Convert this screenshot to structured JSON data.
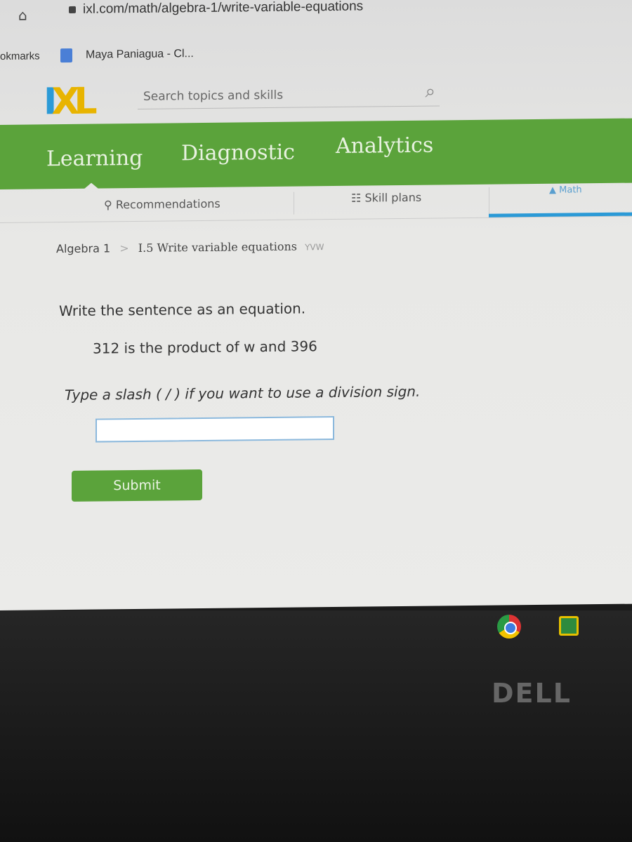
{
  "browser": {
    "url": "ixl.com/math/algebra-1/write-variable-equations",
    "bookmarks_label": "okmarks",
    "bookmark": "Maya Paniagua - Cl..."
  },
  "header": {
    "logo": "IXL",
    "search_placeholder": "Search topics and skills"
  },
  "nav": {
    "items": [
      "Learning",
      "Diagnostic",
      "Analytics"
    ]
  },
  "subnav": {
    "items": [
      "Recommendations",
      "Skill plans",
      "Math"
    ]
  },
  "breadcrumb": {
    "subject": "Algebra 1",
    "separator": ">",
    "skill": "I.5 Write variable equations",
    "code": "YVW"
  },
  "question": {
    "prompt": "Write the sentence as an equation.",
    "statement": "312 is the product of w and 396",
    "hint": "Type a slash ( / ) if you want to use a division sign.",
    "answer": "",
    "submit": "Submit"
  },
  "device": {
    "brand": "DELL"
  },
  "colors": {
    "green": "#5ba33b",
    "blue": "#2b9ad6",
    "logo_yellow": "#e8b400"
  }
}
